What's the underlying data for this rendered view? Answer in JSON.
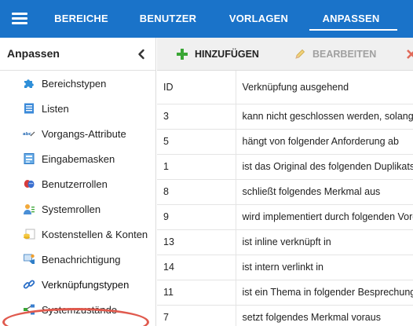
{
  "topbar": {
    "tabs": [
      {
        "label": "BEREICHE"
      },
      {
        "label": "BENUTZER"
      },
      {
        "label": "VORLAGEN"
      },
      {
        "label": "ANPASSEN"
      }
    ],
    "active_tab": "ANPASSEN"
  },
  "sidebar": {
    "title": "Anpassen",
    "items": [
      {
        "label": "Bereichstypen",
        "icon": "puzzle-icon"
      },
      {
        "label": "Listen",
        "icon": "list-icon"
      },
      {
        "label": "Vorgangs-Attribute",
        "icon": "abc-attribute-icon"
      },
      {
        "label": "Eingabemasken",
        "icon": "form-icon"
      },
      {
        "label": "Benutzerrollen",
        "icon": "masks-icon"
      },
      {
        "label": "Systemrollen",
        "icon": "user-role-icon"
      },
      {
        "label": "Kostenstellen & Konten",
        "icon": "coins-icon"
      },
      {
        "label": "Benachrichtigung",
        "icon": "notification-icon"
      },
      {
        "label": "Verknüpfungstypen",
        "icon": "link-icon"
      },
      {
        "label": "Systemzustände",
        "icon": "network-icon"
      }
    ],
    "active_item": "Verknüpfungstypen"
  },
  "toolbar": {
    "add_label": "HINZUFÜGEN",
    "edit_label": "BEARBEITEN"
  },
  "table": {
    "columns": [
      "ID",
      "Verknüpfung ausgehend"
    ],
    "rows": [
      {
        "id": "3",
        "name": "kann nicht geschlossen werden, solange"
      },
      {
        "id": "5",
        "name": "hängt von folgender Anforderung ab"
      },
      {
        "id": "1",
        "name": "ist das Original des folgenden Duplikats"
      },
      {
        "id": "8",
        "name": "schließt folgendes Merkmal aus"
      },
      {
        "id": "9",
        "name": "wird implementiert durch folgenden Vorgang"
      },
      {
        "id": "13",
        "name": "ist inline verknüpft in"
      },
      {
        "id": "14",
        "name": "ist intern verlinkt in"
      },
      {
        "id": "11",
        "name": "ist ein Thema in folgender Besprechung"
      },
      {
        "id": "7",
        "name": "setzt folgendes Merkmal voraus"
      }
    ]
  },
  "colors": {
    "topbar": "#1a73c9",
    "highlight": "#e05a4e",
    "add_icon": "#3aa635"
  }
}
